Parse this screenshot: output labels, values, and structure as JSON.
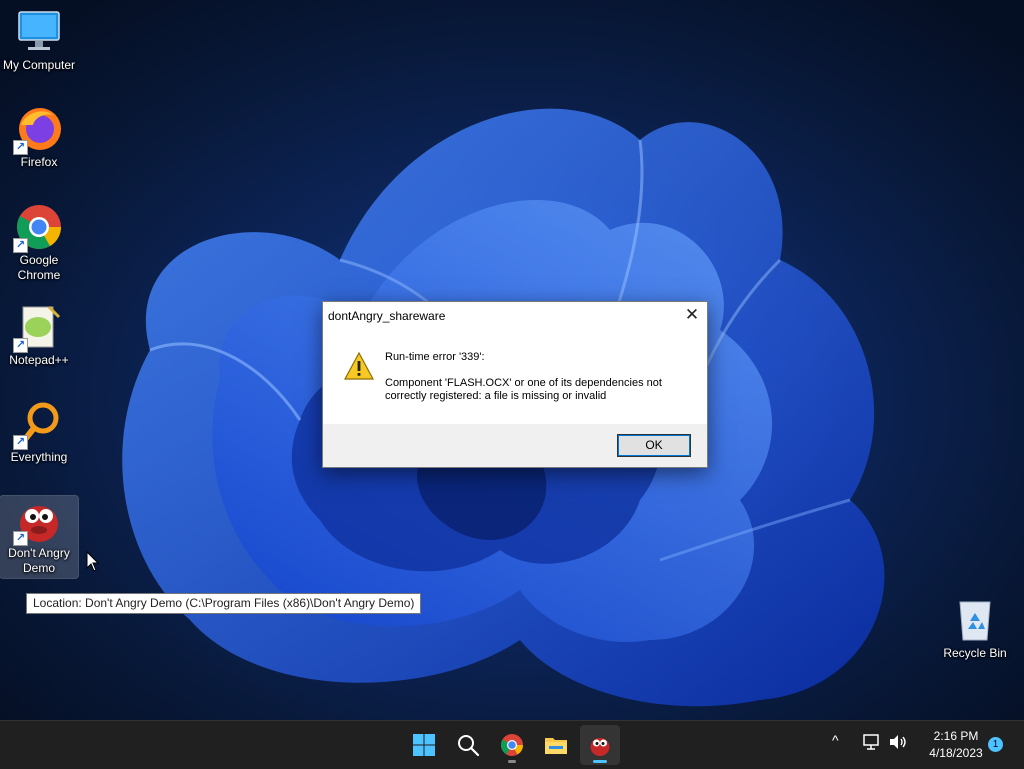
{
  "desktop": {
    "icons": [
      {
        "label": "My Computer"
      },
      {
        "label": "Firefox"
      },
      {
        "label": "Google Chrome"
      },
      {
        "label": "Notepad++"
      },
      {
        "label": "Everything"
      },
      {
        "label": "Don't Angry Demo"
      },
      {
        "label": "Recycle Bin"
      }
    ],
    "tooltip": "Location: Don't Angry Demo (C:\\Program Files (x86)\\Don't Angry Demo)",
    "shortcut_glyph": "↗"
  },
  "dialog": {
    "title": "dontAngry_shareware",
    "close_glyph": "✕",
    "error_line": "Run-time error '339':",
    "message": "Component 'FLASH.OCX' or one of its dependencies not correctly registered: a file is missing or invalid",
    "ok_label": "OK"
  },
  "taskbar": {
    "icons": [
      "windows-start",
      "search",
      "google-chrome",
      "file-explorer",
      "dont-angry-demo"
    ],
    "tray": {
      "chevron": "^",
      "time": "2:16 PM",
      "date": "4/18/2023",
      "notification_count": "1"
    }
  },
  "colors": {
    "accent": "#4cc2ff",
    "taskbar_bg": "#202020",
    "dialog_bg": "#f0f0f0"
  }
}
